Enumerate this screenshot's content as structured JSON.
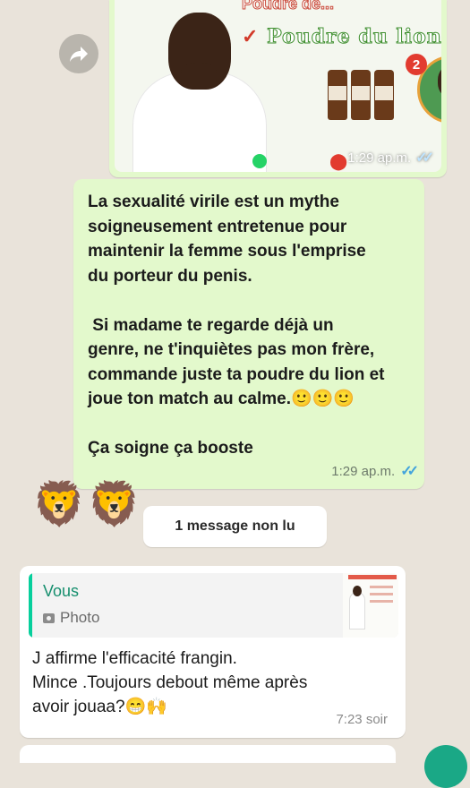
{
  "top_image_message": {
    "ad_heading_partial": "Poudre de...",
    "ad_line": "Poudre du lion",
    "ad_check": "✓",
    "badge": "2",
    "time": "1:29 ap.m.",
    "ticks": "✓✓"
  },
  "outgoing_message": {
    "text": "La sexualité virile est un mythe\nsoigneusement entretenue pour\nmaintenir la femme sous l'emprise\ndu porteur du penis.\n\n Si madame te regarde déjà un\ngenre, ne t'inquiètes pas mon frère,\ncommande juste ta poudre du lion et\njoue ton match au calme.🙂🙂🙂\n\nÇa soigne ça booste",
    "time": "1:29 ap.m.",
    "ticks": "✓✓"
  },
  "emoji_message": {
    "text": "🦁🦁"
  },
  "unread_divider": {
    "label": "1 message non lu"
  },
  "incoming_message": {
    "quote_sender": "Vous",
    "quote_type": "Photo",
    "text": "J affirme l'efficacité frangin.\nMince .Toujours debout même après\navoir jouaa?😁🙌",
    "time": "7:23 soir"
  },
  "colors": {
    "chat_background": "#e9e3da",
    "outgoing_bubble": "#e3f9cc",
    "incoming_bubble": "#ffffff",
    "accent_green": "#06cf9c",
    "read_ticks": "#43a4dc"
  },
  "icons": {
    "forward": "forward-arrow-icon",
    "quote_media": "camera-icon",
    "location": "location-pin-icon"
  }
}
